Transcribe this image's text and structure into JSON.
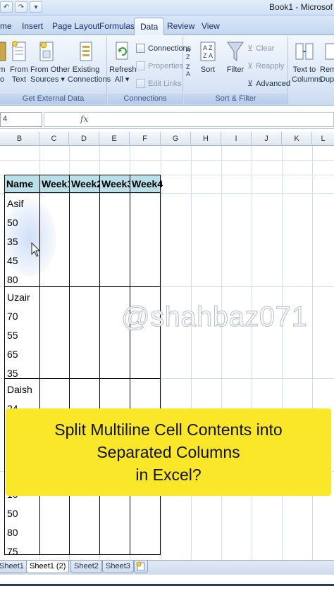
{
  "window": {
    "title": "Book1 - Microsof"
  },
  "tabs": [
    {
      "label": "me"
    },
    {
      "label": "Insert"
    },
    {
      "label": "Page Layout"
    },
    {
      "label": "Formulas"
    },
    {
      "label": "Data",
      "active": true
    },
    {
      "label": "Review"
    },
    {
      "label": "View"
    }
  ],
  "ribbon": {
    "get_external_data": {
      "label": "Get External Data",
      "buttons": {
        "from_access_1": "m",
        "from_access_2": "o",
        "from_text_1": "From",
        "from_text_2": "Text",
        "from_other_1": "From Other",
        "from_other_2": "Sources",
        "existing_1": "Existing",
        "existing_2": "Connections"
      }
    },
    "connections": {
      "label": "Connections",
      "refresh_1": "Refresh",
      "refresh_2": "All",
      "connections": "Connections",
      "properties": "Properties",
      "edit_links": "Edit Links"
    },
    "sort_filter": {
      "label": "Sort & Filter",
      "sort": "Sort",
      "filter": "Filter",
      "clear": "Clear",
      "reapply": "Reapply",
      "advanced": "Advanced"
    },
    "data_tools": {
      "text_to_1": "Text to",
      "text_to_2": "Columns",
      "remove_1": "Rem",
      "remove_2": "Dupli"
    }
  },
  "formula_bar": {
    "name_box": "4",
    "fx": "fx"
  },
  "columns": [
    "B",
    "C",
    "D",
    "E",
    "F",
    "G",
    "H",
    "I",
    "J",
    "K",
    "L"
  ],
  "table": {
    "headers": [
      "Name",
      "Week1",
      "Week2",
      "Week3",
      "Week4"
    ],
    "blocks": [
      {
        "lines": [
          "Asif",
          "50",
          "35",
          "45",
          "80"
        ]
      },
      {
        "lines": [
          "Uzair",
          "70",
          "55",
          "65",
          "35"
        ]
      },
      {
        "lines": [
          "Daish",
          "24"
        ]
      },
      {
        "lines": [
          "10",
          "50",
          "80",
          "75"
        ]
      }
    ]
  },
  "watermark": "@shahbaz071",
  "caption": {
    "line1": "Split Multiline Cell Contents into",
    "line2": "Separated Columns",
    "line3": "in Excel?"
  },
  "sheets": [
    "Sheet1",
    "Sheet1 (2)",
    "Sheet2",
    "Sheet3"
  ],
  "colors": {
    "header_fill": "#b9dfe8",
    "caption_bg": "#fbe72a",
    "ribbon_blue": "#c4d7f0"
  }
}
